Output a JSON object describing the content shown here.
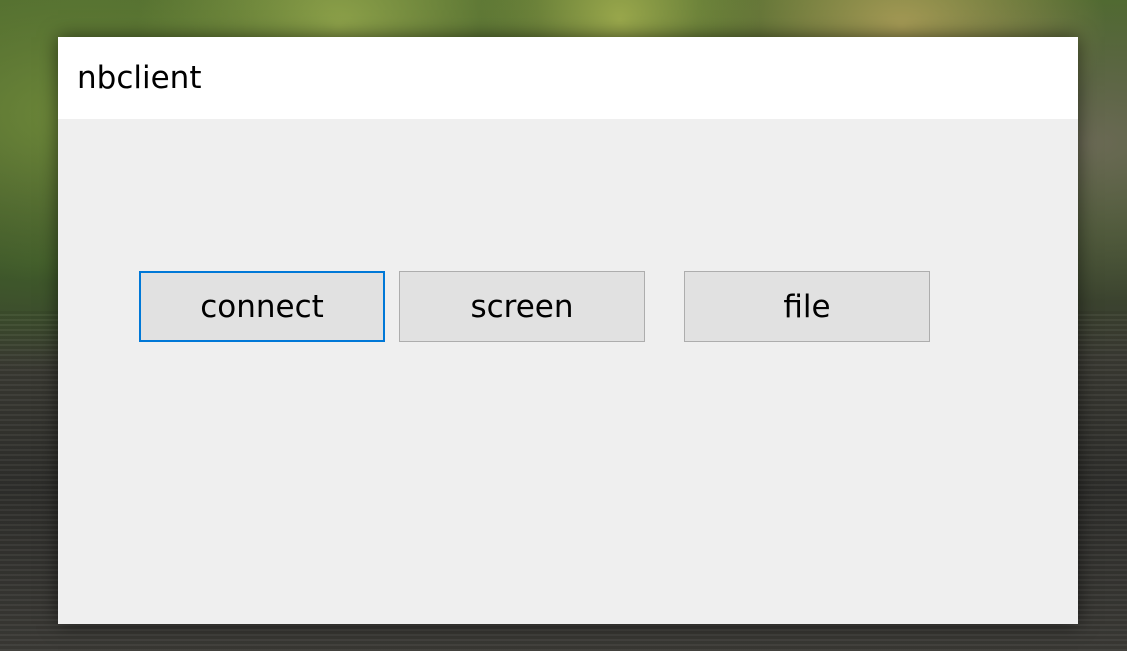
{
  "window": {
    "title": "nbclient"
  },
  "buttons": {
    "connect": "connect",
    "screen": "screen",
    "file": "file"
  },
  "colors": {
    "accent_focus": "#0078d7",
    "button_bg": "#e1e1e1",
    "client_bg": "#efefef"
  }
}
